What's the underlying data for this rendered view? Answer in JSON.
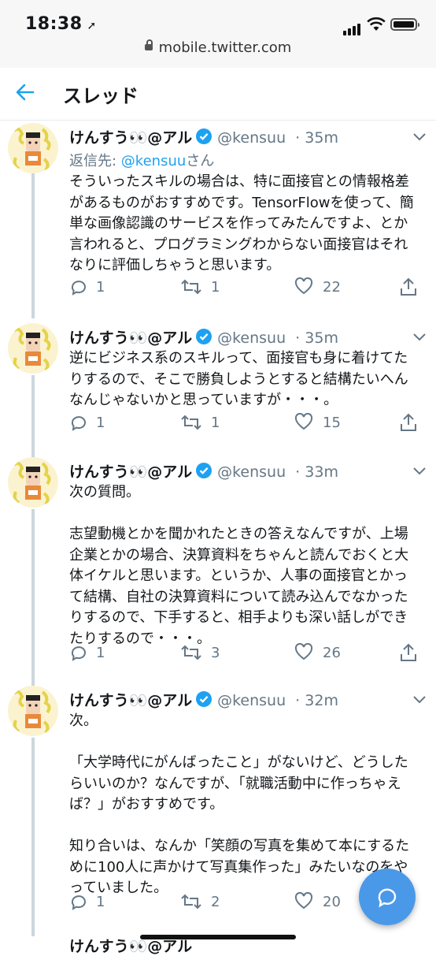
{
  "status_bar": {
    "time": "18:38",
    "location_glyph": "➚"
  },
  "browser": {
    "url": "mobile.twitter.com"
  },
  "header": {
    "back_icon": "arrow-left-icon",
    "title": "スレッド"
  },
  "colors": {
    "accent": "#1da1f2",
    "muted": "#657786",
    "fab": "#4a99e9"
  },
  "tweets": [
    {
      "name": "けんすう👀@アル",
      "handle": "@kensuu",
      "time": "35m",
      "reply_prefix": "返信先: ",
      "reply_user": "@kensuu",
      "reply_suffix": "さん",
      "lines": [
        "そういったスキルの場合は、特に面接官との情報格差",
        "があるものがおすすめです。TensorFlowを使って、簡",
        "単な画像認識のサービスを作ってみたんですよ、とか",
        "言われると、プログラミングわからない面接官はそれ",
        "なりに評価しちゃうと思います。"
      ],
      "replies": "1",
      "retweets": "1",
      "likes": "22"
    },
    {
      "name": "けんすう👀@アル",
      "handle": "@kensuu",
      "time": "35m",
      "lines": [
        "逆にビジネス系のスキルって、面接官も身に着けてた",
        "りするので、そこで勝負しようとすると結構たいへん",
        "なんじゃないかと思っていますが・・・。"
      ],
      "replies": "1",
      "retweets": "1",
      "likes": "15"
    },
    {
      "name": "けんすう👀@アル",
      "handle": "@kensuu",
      "time": "33m",
      "lines": [
        "次の質問。",
        "",
        "志望動機とかを聞かれたときの答えなんですが、上場",
        "企業とかの場合、決算資料をちゃんと読んでおくと大",
        "体イケルと思います。というか、人事の面接官とかっ",
        "て結構、自社の決算資料について読み込んでなかった",
        "りするので、下手すると、相手よりも深い話しができ",
        "たりするので・・・。"
      ],
      "replies": "1",
      "retweets": "3",
      "likes": "26"
    },
    {
      "name": "けんすう👀@アル",
      "handle": "@kensuu",
      "time": "32m",
      "lines": [
        "次。",
        "",
        "「大学時代にがんばったこと」がないけど、どうした",
        "らいいのか？なんですが、「就職活動中に作っちゃえ",
        "ば？」がおすすめです。",
        "",
        "知り合いは、なんか「笑顔の写真を集めて本にするた",
        "めに100人に声かけて写真集作った」みたいなのをや",
        "っていました。"
      ],
      "replies": "1",
      "retweets": "2",
      "likes": "20"
    },
    {
      "name": "けんすう👀@アル"
    }
  ],
  "fab_icon": "compose-reply-icon"
}
